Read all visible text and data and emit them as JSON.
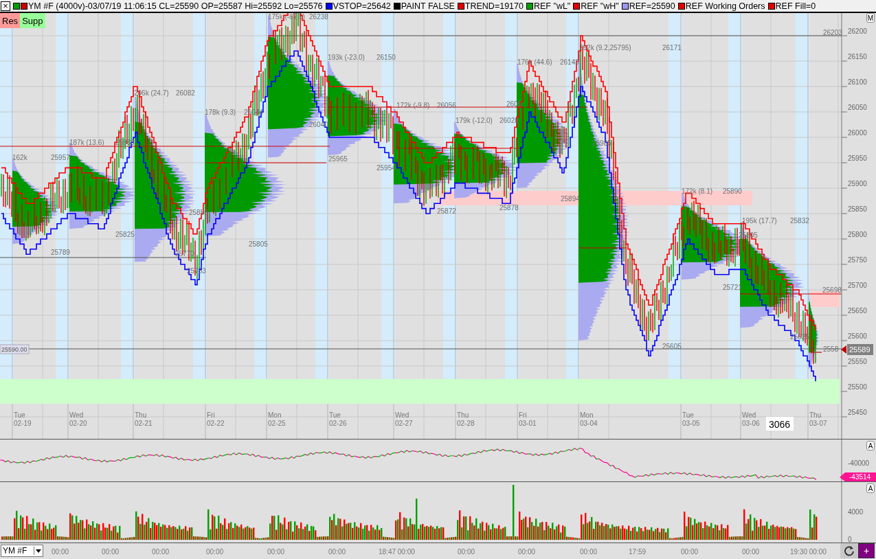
{
  "legend": {
    "close_glyph": "×",
    "items": [
      {
        "swatches": [
          {
            "color": "#00a000"
          },
          {
            "color": "#d00000"
          }
        ],
        "text": "YM #F (4000v)-03/07/19 11:06:15 CL=25590 OP=25587 Hi=25592 Lo=25576"
      },
      {
        "swatches": [
          {
            "color": "#0000ff"
          }
        ],
        "text": "VSTOP=25642"
      },
      {
        "swatches": [
          {
            "color": "#000000"
          }
        ],
        "text": "PAINT FALSE"
      },
      {
        "swatches": [
          {
            "color": "#e00000"
          }
        ],
        "text": "TREND=19170"
      },
      {
        "swatches": [
          {
            "color": "#00a000"
          }
        ],
        "text": "REF \"wL\""
      },
      {
        "swatches": [
          {
            "color": "#e00000"
          }
        ],
        "text": "REF \"wH\""
      },
      {
        "swatches": [
          {
            "color": "#9999ee"
          }
        ],
        "text": "REF=25590"
      },
      {
        "swatches": [
          {
            "color": "#e00000"
          }
        ],
        "text": "REF Working Orders"
      },
      {
        "swatches": [
          {
            "color": "#e00000"
          }
        ],
        "text": "REF Fill=0"
      }
    ]
  },
  "zone_buttons": [
    {
      "label": "Res",
      "kind": "resistance"
    },
    {
      "label": "Supp",
      "kind": "support"
    }
  ],
  "mode_button": "M",
  "price_chart": {
    "annotations": [
      "175k (-67.5)",
      "26238",
      "26203",
      "292k (9.2,25795)",
      "26171",
      "193k (-23.0)",
      "26150",
      "176k (44.6)",
      "26143",
      "206k (24.7)",
      "26082",
      "172k (-9.8)",
      "26056",
      "2606",
      "26040",
      "178k (9.3)",
      "26044",
      "179k (-12.0)",
      "26028",
      "187k (13.6)",
      "25988",
      "25985",
      "162k",
      "25957",
      "25965",
      "25954",
      "25872",
      "25878",
      "25894",
      "172k (8.1)",
      "25890",
      "195k (17.7)",
      "25832",
      "25825",
      "25850",
      "25805",
      "25805",
      "25789",
      "25770",
      "25753",
      "25721",
      "25698",
      "25625",
      "25605",
      "2558"
    ],
    "days": [
      {
        "weekday": "Tue",
        "date": "02-19"
      },
      {
        "weekday": "Wed",
        "date": "02-20"
      },
      {
        "weekday": "Thu",
        "date": "02-21"
      },
      {
        "weekday": "Fri",
        "date": "02-22"
      },
      {
        "weekday": "Mon",
        "date": "02-25"
      },
      {
        "weekday": "Tue",
        "date": "02-26"
      },
      {
        "weekday": "Wed",
        "date": "02-27"
      },
      {
        "weekday": "Thu",
        "date": "02-28"
      },
      {
        "weekday": "Fri",
        "date": "03-01"
      },
      {
        "weekday": "Mon",
        "date": "03-04"
      },
      {
        "weekday": "Tue",
        "date": "03-05"
      },
      {
        "weekday": "Wed",
        "date": "03-06"
      },
      {
        "weekday": "Thu",
        "date": "03-07"
      }
    ],
    "ref_price": "25590.00",
    "bar_count": "3066",
    "axis_ticks": [
      "26200",
      "26150",
      "26100",
      "26050",
      "26000",
      "25950",
      "25900",
      "25850",
      "25800",
      "25750",
      "25700",
      "25650",
      "25600",
      "25550",
      "25500",
      "25450"
    ],
    "last_price": "25589"
  },
  "indicator": {
    "tick": "-40000",
    "last_value": "-43514",
    "autoscale": "A"
  },
  "volume": {
    "ticks": [
      "4000",
      "0"
    ],
    "autoscale": "A"
  },
  "bottom_bar": {
    "symbol": "YM #F",
    "time_labels": [
      "00:00",
      "00:00",
      "00:00",
      "00:00",
      "00:00",
      "00:00",
      "18:47 00:00",
      "00:00",
      "00:00",
      "00:00",
      "17:59",
      "00:00",
      "00:00",
      "19:30 00:00"
    ],
    "add_button": "+"
  }
}
